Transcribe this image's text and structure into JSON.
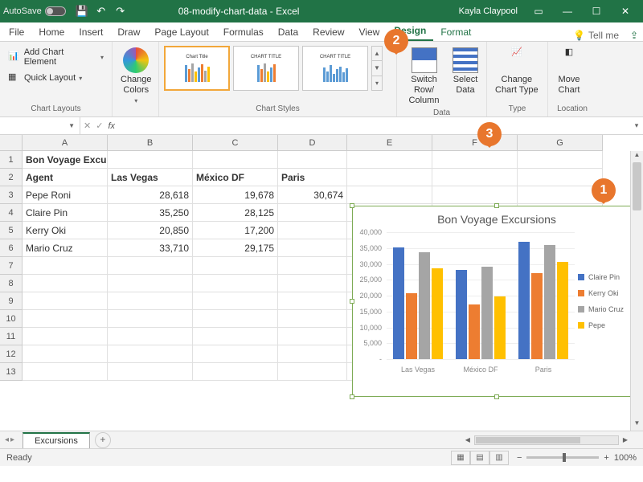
{
  "titlebar": {
    "autosave_label": "AutoSave",
    "autosave_state": "Off",
    "filename": "08-modify-chart-data - Excel",
    "user": "Kayla Claypool"
  },
  "tabs": {
    "file": "File",
    "home": "Home",
    "insert": "Insert",
    "draw": "Draw",
    "pagelayout": "Page Layout",
    "formulas": "Formulas",
    "data": "Data",
    "review": "Review",
    "view": "View",
    "design": "Design",
    "format": "Format",
    "tellme": "Tell me"
  },
  "ribbon": {
    "layouts": {
      "add_element": "Add Chart Element",
      "quick_layout": "Quick Layout",
      "group": "Chart Layouts"
    },
    "colors": {
      "change_colors": "Change Colors",
      "group_empty": ""
    },
    "styles": {
      "t1": "Chart Title",
      "t2": "CHART TITLE",
      "t3": "CHART TITLE",
      "group": "Chart Styles"
    },
    "data": {
      "switch": "Switch Row/\nColumn",
      "select": "Select\nData",
      "group": "Data"
    },
    "type": {
      "change": "Change\nChart Type",
      "group": "Type"
    },
    "location": {
      "move": "Move\nChart",
      "group": "Location"
    }
  },
  "formula_bar": {
    "name_box": "",
    "formula": ""
  },
  "columns": [
    "A",
    "B",
    "C",
    "D",
    "E",
    "F",
    "G"
  ],
  "rows_shown": 13,
  "sheet": {
    "title": "Bon Voyage Excursions",
    "headers": {
      "agent": "Agent",
      "lv": "Las Vegas",
      "mx": "México DF",
      "pa": "Paris"
    },
    "rows": [
      {
        "agent": "Pepe Roni",
        "lv": "28,618",
        "mx": "19,678",
        "pa": "30,674"
      },
      {
        "agent": "Claire Pin",
        "lv": "35,250",
        "mx": "28,125",
        "pa": ""
      },
      {
        "agent": "Kerry Oki",
        "lv": "20,850",
        "mx": "17,200",
        "pa": ""
      },
      {
        "agent": "Mario Cruz",
        "lv": "33,710",
        "mx": "29,175",
        "pa": ""
      }
    ]
  },
  "chart_data": {
    "type": "bar",
    "title": "Bon Voyage Excursions",
    "categories": [
      "Las Vegas",
      "México DF",
      "Paris"
    ],
    "series": [
      {
        "name": "Claire Pin",
        "values": [
          35250,
          28125,
          37000
        ],
        "color": "#4472c4"
      },
      {
        "name": "Kerry Oki",
        "values": [
          20850,
          17200,
          27000
        ],
        "color": "#ed7d31"
      },
      {
        "name": "Mario Cruz",
        "values": [
          33710,
          29175,
          36000
        ],
        "color": "#a5a5a5"
      },
      {
        "name": "Pepe",
        "values": [
          28618,
          19678,
          30674
        ],
        "color": "#ffc000"
      }
    ],
    "ylabel": "",
    "xlabel": "",
    "ylim": [
      0,
      40000
    ],
    "y_ticks": [
      0,
      5000,
      10000,
      15000,
      20000,
      25000,
      30000,
      35000,
      40000
    ],
    "y_tick_labels": [
      "-",
      "5,000",
      "10,000",
      "15,000",
      "20,000",
      "25,000",
      "30,000",
      "35,000",
      "40,000"
    ],
    "legend_position": "right"
  },
  "sheet_tab": {
    "name": "Excursions"
  },
  "status": {
    "ready": "Ready",
    "zoom": "100%"
  },
  "callouts": {
    "c1": "1",
    "c2": "2",
    "c3": "3"
  }
}
